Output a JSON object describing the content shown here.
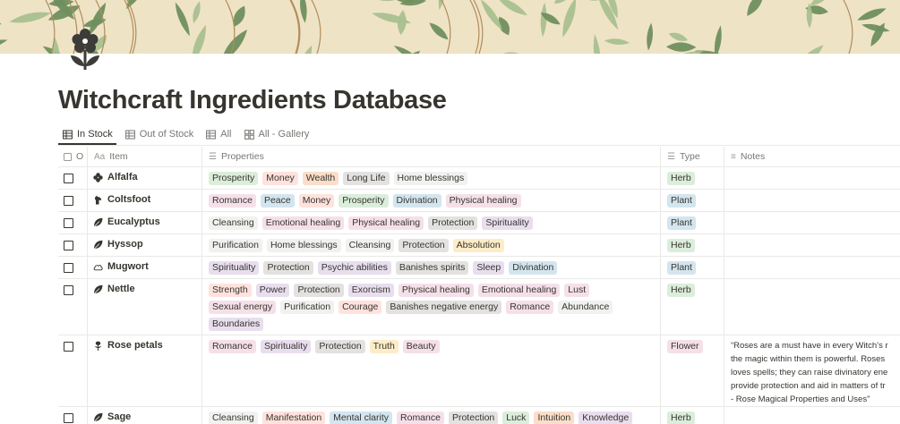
{
  "page": {
    "title": "Witchcraft Ingredients Database",
    "icon": "flower-icon",
    "cover": "leaf-pattern-cover"
  },
  "colors": {
    "cover_bg": "#efe3c6",
    "leaf_dark": "#6f8f5e",
    "leaf_light": "#a9c08f",
    "text": "#37352f",
    "muted": "#787774"
  },
  "tabs": [
    {
      "label": "In Stock",
      "icon": "table-icon",
      "active": true
    },
    {
      "label": "Out of Stock",
      "icon": "table-icon",
      "active": false
    },
    {
      "label": "All",
      "icon": "table-icon",
      "active": false
    },
    {
      "label": "All - Gallery",
      "icon": "gallery-icon",
      "active": false
    }
  ],
  "columns": {
    "check": "O",
    "item": "Item",
    "properties": "Properties",
    "type": "Type",
    "notes": "Notes"
  },
  "rows": [
    {
      "name": "Alfalfa",
      "icon": "clover-icon",
      "tags": [
        [
          "Prosperity",
          "green"
        ],
        [
          "Money",
          "red"
        ],
        [
          "Wealth",
          "orange"
        ],
        [
          "Long Life",
          "gray"
        ],
        [
          "Home blessings",
          "plain"
        ]
      ],
      "type": [
        "Herb",
        "green"
      ],
      "notes": []
    },
    {
      "name": "Coltsfoot",
      "icon": "horse-icon",
      "tags": [
        [
          "Romance",
          "pink"
        ],
        [
          "Peace",
          "blue"
        ],
        [
          "Money",
          "red"
        ],
        [
          "Prosperity",
          "green"
        ],
        [
          "Divination",
          "blue"
        ],
        [
          "Physical healing",
          "pink"
        ]
      ],
      "type": [
        "Plant",
        "blue"
      ],
      "notes": []
    },
    {
      "name": "Eucalyptus",
      "icon": "leaf-icon",
      "tags": [
        [
          "Cleansing",
          "plain"
        ],
        [
          "Emotional healing",
          "pink"
        ],
        [
          "Physical healing",
          "pink"
        ],
        [
          "Protection",
          "gray"
        ],
        [
          "Spirituality",
          "purple"
        ]
      ],
      "type": [
        "Plant",
        "blue"
      ],
      "notes": []
    },
    {
      "name": "Hyssop",
      "icon": "leaf-icon",
      "tags": [
        [
          "Purification",
          "plain"
        ],
        [
          "Home blessings",
          "plain"
        ],
        [
          "Cleansing",
          "plain"
        ],
        [
          "Protection",
          "gray"
        ],
        [
          "Absolution",
          "yellow"
        ]
      ],
      "type": [
        "Herb",
        "green"
      ],
      "notes": []
    },
    {
      "name": "Mugwort",
      "icon": "cloud-icon",
      "tags": [
        [
          "Spirituality",
          "purple"
        ],
        [
          "Protection",
          "gray"
        ],
        [
          "Psychic abilities",
          "purple"
        ],
        [
          "Banishes spirits",
          "gray"
        ],
        [
          "Sleep",
          "purple"
        ],
        [
          "Divination",
          "blue"
        ]
      ],
      "type": [
        "Plant",
        "blue"
      ],
      "notes": []
    },
    {
      "name": "Nettle",
      "icon": "leaf-icon",
      "tags": [
        [
          "Strength",
          "red"
        ],
        [
          "Power",
          "purple"
        ],
        [
          "Protection",
          "gray"
        ],
        [
          "Exorcism",
          "purple"
        ],
        [
          "Physical healing",
          "pink"
        ],
        [
          "Emotional healing",
          "pink"
        ],
        [
          "Lust",
          "pink"
        ],
        [
          "Sexual energy",
          "pink"
        ],
        [
          "Purification",
          "plain"
        ],
        [
          "Courage",
          "red"
        ],
        [
          "Banishes negative energy",
          "gray"
        ],
        [
          "Romance",
          "pink"
        ],
        [
          "Abundance",
          "plain"
        ],
        [
          "Boundaries",
          "purple"
        ]
      ],
      "type": [
        "Herb",
        "green"
      ],
      "notes": []
    },
    {
      "name": "Rose petals",
      "icon": "rose-icon",
      "tags": [
        [
          "Romance",
          "pink"
        ],
        [
          "Spirituality",
          "purple"
        ],
        [
          "Protection",
          "gray"
        ],
        [
          "Truth",
          "yellow"
        ],
        [
          "Beauty",
          "pink"
        ]
      ],
      "type": [
        "Flower",
        "pink"
      ],
      "notes": [
        "“Roses are a must have in every Witch’s r",
        "the magic within them is powerful. Roses",
        "loves spells; they can raise divinatory ene",
        "provide protection and aid in matters of tr",
        "- Rose Magical Properties and Uses”"
      ]
    },
    {
      "name": "Sage",
      "icon": "leaf-icon",
      "tags": [
        [
          "Cleansing",
          "plain"
        ],
        [
          "Manifestation",
          "red"
        ],
        [
          "Mental clarity",
          "blue"
        ],
        [
          "Romance",
          "pink"
        ],
        [
          "Protection",
          "gray"
        ],
        [
          "Luck",
          "green"
        ],
        [
          "Intuition",
          "orange"
        ],
        [
          "Knowledge",
          "purple"
        ]
      ],
      "type": [
        "Herb",
        "green"
      ],
      "notes": []
    }
  ]
}
